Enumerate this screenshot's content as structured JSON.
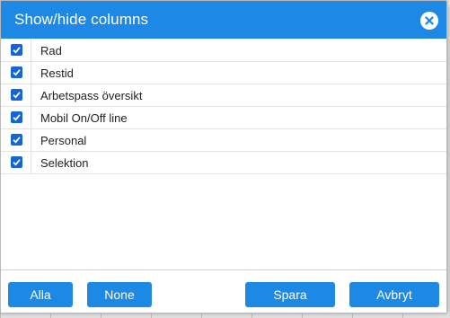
{
  "dialog": {
    "title": "Show/hide columns",
    "close_icon": "close-icon"
  },
  "columns": [
    {
      "label": "Rad",
      "checked": true
    },
    {
      "label": "Restid",
      "checked": true
    },
    {
      "label": "Arbetspass översikt",
      "checked": true
    },
    {
      "label": "Mobil On/Off line",
      "checked": true
    },
    {
      "label": "Personal",
      "checked": true
    },
    {
      "label": "Selektion",
      "checked": true
    }
  ],
  "footer": {
    "all_label": "Alla",
    "none_label": "None",
    "save_label": "Spara",
    "cancel_label": "Avbryt"
  },
  "colors": {
    "accent": "#1e88e5",
    "checkbox": "#1565d8"
  }
}
